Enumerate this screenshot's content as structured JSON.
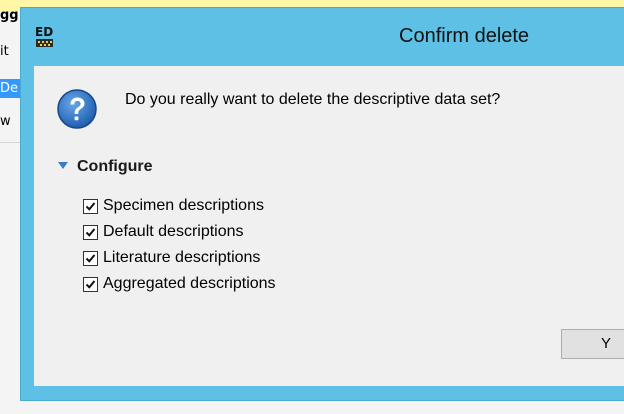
{
  "background": {
    "fragments": [
      "gg",
      "it",
      "De",
      "w"
    ]
  },
  "dialog": {
    "title": "Confirm delete",
    "app_icon_label": "ED",
    "icons": {
      "app": "app-ed-icon",
      "question": "question-icon",
      "expand": "triangle-down-icon",
      "check": "check-icon"
    },
    "message": "Do you really want to delete the descriptive data set?",
    "section_label": "Configure",
    "options": [
      {
        "label": "Specimen descriptions",
        "checked": true
      },
      {
        "label": "Default descriptions",
        "checked": true
      },
      {
        "label": "Literature descriptions",
        "checked": true
      },
      {
        "label": "Aggregated descriptions",
        "checked": true
      }
    ],
    "confirm_button_label": "Y"
  },
  "colors": {
    "frame": "#5ec0e4",
    "client": "#f0f0f0",
    "question_icon": "#1f5fb0",
    "selection": "#3399ff"
  }
}
